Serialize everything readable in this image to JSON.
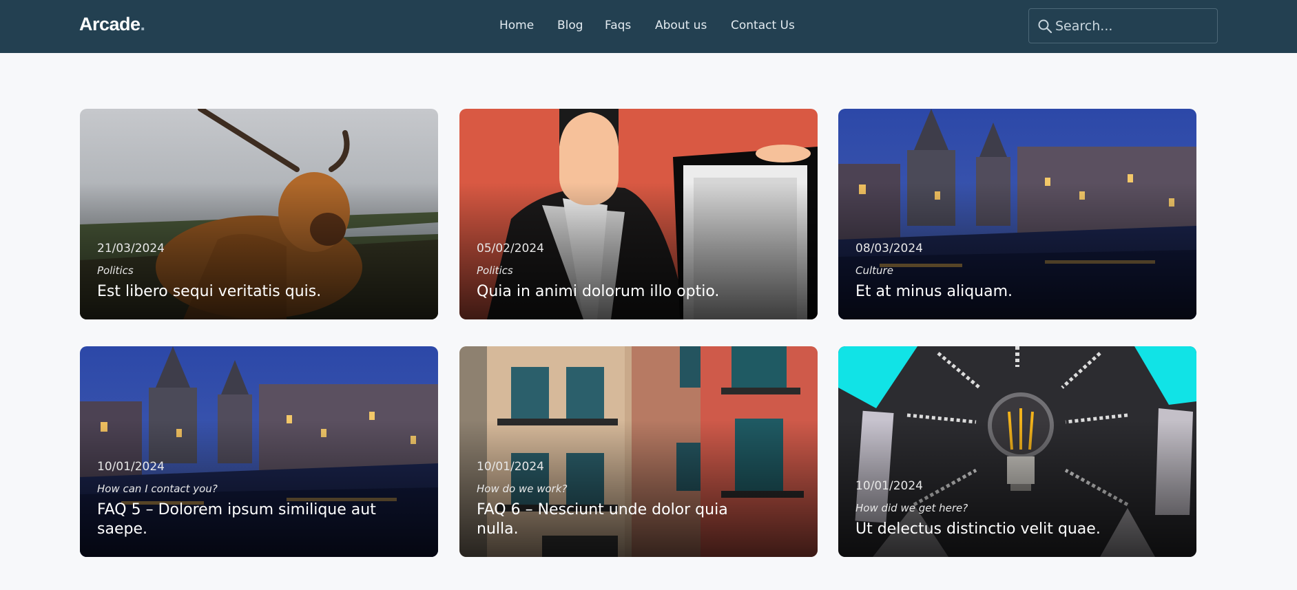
{
  "header": {
    "brand": "Arcade",
    "brand_dot": ".",
    "nav": [
      "Home",
      "Blog",
      "Faqs",
      "About us",
      "Contact Us"
    ],
    "search_placeholder": "Search..."
  },
  "posts": [
    {
      "date": "21/03/2024",
      "category": "Politics",
      "title": "Est libero sequi veritatis quis.",
      "image": "highland-cow"
    },
    {
      "date": "05/02/2024",
      "category": "Politics",
      "title": "Quia in animi dolorum illo optio.",
      "image": "person-holding-sign"
    },
    {
      "date": "08/03/2024",
      "category": "Culture",
      "title": "Et at minus aliquam.",
      "image": "canal-city-night"
    },
    {
      "date": "10/01/2024",
      "category": "How can I contact you?",
      "title": "FAQ 5 – Dolorem ipsum similique aut saepe.",
      "image": "canal-city-night"
    },
    {
      "date": "10/01/2024",
      "category": "How do we work?",
      "title": "FAQ 6 – Nesciunt unde dolor quia nulla.",
      "image": "building-facade"
    },
    {
      "date": "10/01/2024",
      "category": "How did we get here?",
      "title": "Ut delectus distinctio velit quae.",
      "image": "light-bulb"
    }
  ],
  "colors": {
    "header": "#234051",
    "background": "#f7f8fa",
    "accent": "#00e5e5"
  }
}
